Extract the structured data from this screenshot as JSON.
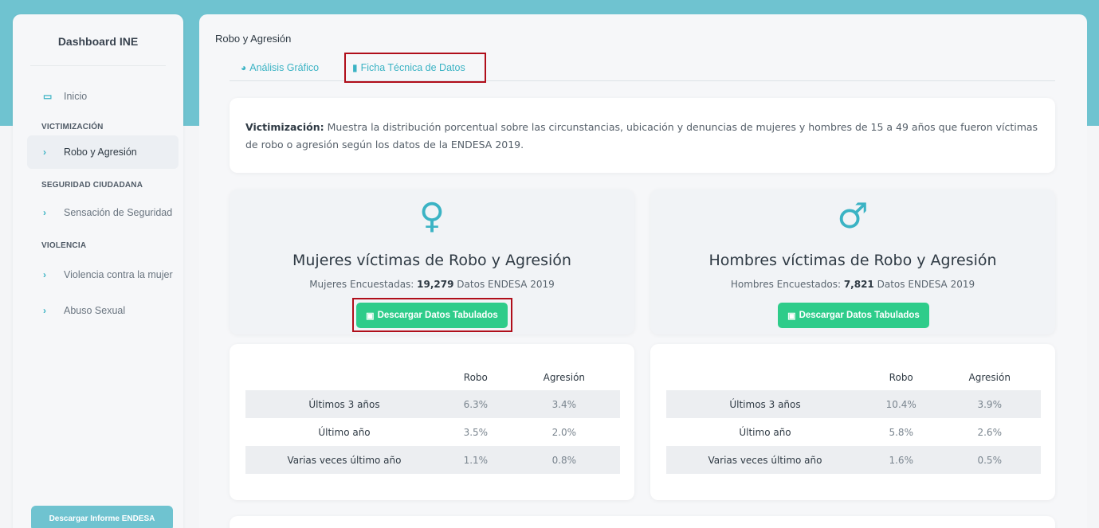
{
  "sidebar": {
    "brand": "Dashboard INE",
    "inicio": "Inicio",
    "sections": [
      "VICTIMIZACIÓN",
      "SEGURIDAD CIUDADANA",
      "VIOLENCIA"
    ],
    "items": [
      {
        "label": "Robo y Agresión",
        "active": true
      },
      {
        "label": "Sensación de Seguridad"
      },
      {
        "label": "Violencia contra la mujer"
      },
      {
        "label": "Abuso Sexual"
      }
    ],
    "download_button": "Descargar Informe ENDESA"
  },
  "main": {
    "page_title": "Robo y Agresión",
    "tabs": [
      {
        "label": "Análisis Gráfico",
        "icon": "pie-chart-icon"
      },
      {
        "label": "Ficha Técnica de Datos",
        "icon": "file-icon"
      }
    ],
    "description": {
      "lead": "Victimización:",
      "text": " Muestra la distribución porcentual sobre las circunstancias, ubicación y denuncias de mujeres y hombres de 15 a 49 años que fueron víctimas de robo o agresión según los datos de la ENDESA 2019."
    },
    "women": {
      "icon": "♀",
      "title": "Mujeres víctimas de Robo y Agresión",
      "sub_prefix": "Mujeres Encuestadas: ",
      "count": "19,279",
      "sub_suffix": " Datos ENDESA 2019",
      "button": "Descargar Datos Tabulados"
    },
    "men": {
      "icon": "♂",
      "title": "Hombres víctimas de Robo y Agresión",
      "sub_prefix": "Hombres Encuestados: ",
      "count": "7,821",
      "sub_suffix": " Datos ENDESA 2019",
      "button": "Descargar Datos Tabulados"
    },
    "table_headers": [
      "Robo",
      "Agresión"
    ],
    "women_table": [
      {
        "label": "Últimos 3 años",
        "robo": "6.3%",
        "agresion": "3.4%"
      },
      {
        "label": "Último año",
        "robo": "3.5%",
        "agresion": "2.0%"
      },
      {
        "label": "Varias veces último año",
        "robo": "1.1%",
        "agresion": "0.8%"
      }
    ],
    "men_table": [
      {
        "label": "Últimos 3 años",
        "robo": "10.4%",
        "agresion": "3.9%"
      },
      {
        "label": "Último año",
        "robo": "5.8%",
        "agresion": "2.6%"
      },
      {
        "label": "Varias veces último año",
        "robo": "1.6%",
        "agresion": "0.5%"
      }
    ]
  }
}
